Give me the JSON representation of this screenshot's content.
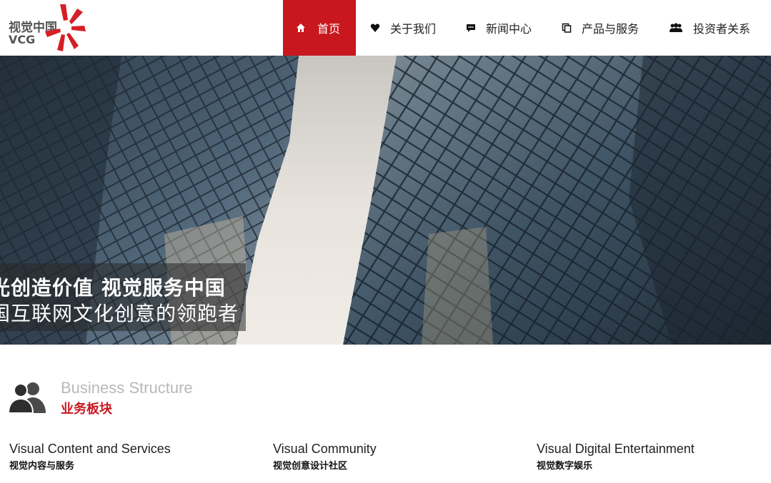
{
  "logo": {
    "cn": "视觉中国",
    "en": "VCG"
  },
  "nav": {
    "items": [
      {
        "label": "首页",
        "icon": "home-icon",
        "active": true
      },
      {
        "label": "关于我们",
        "icon": "heart-icon",
        "active": false
      },
      {
        "label": "新闻中心",
        "icon": "chat-icon",
        "active": false
      },
      {
        "label": "产品与服务",
        "icon": "copy-icon",
        "active": false
      },
      {
        "label": "投资者关系",
        "icon": "users-icon",
        "active": false
      }
    ]
  },
  "hero": {
    "line1": "光创造价值  视觉服务中国",
    "line2": "国互联网文化创意的领跑者"
  },
  "section": {
    "icon": "users-icon",
    "title_en": "Business Structure",
    "title_cn": "业务板块"
  },
  "business": [
    {
      "en": "Visual Content and Services",
      "cn": "视觉内容与服务"
    },
    {
      "en": "Visual Community",
      "cn": "视觉创意设计社区"
    },
    {
      "en": "Visual Digital Entertainment",
      "cn": "视觉数字娱乐"
    }
  ],
  "colors": {
    "accent": "#c8171e",
    "muted": "#b8b8b8"
  }
}
